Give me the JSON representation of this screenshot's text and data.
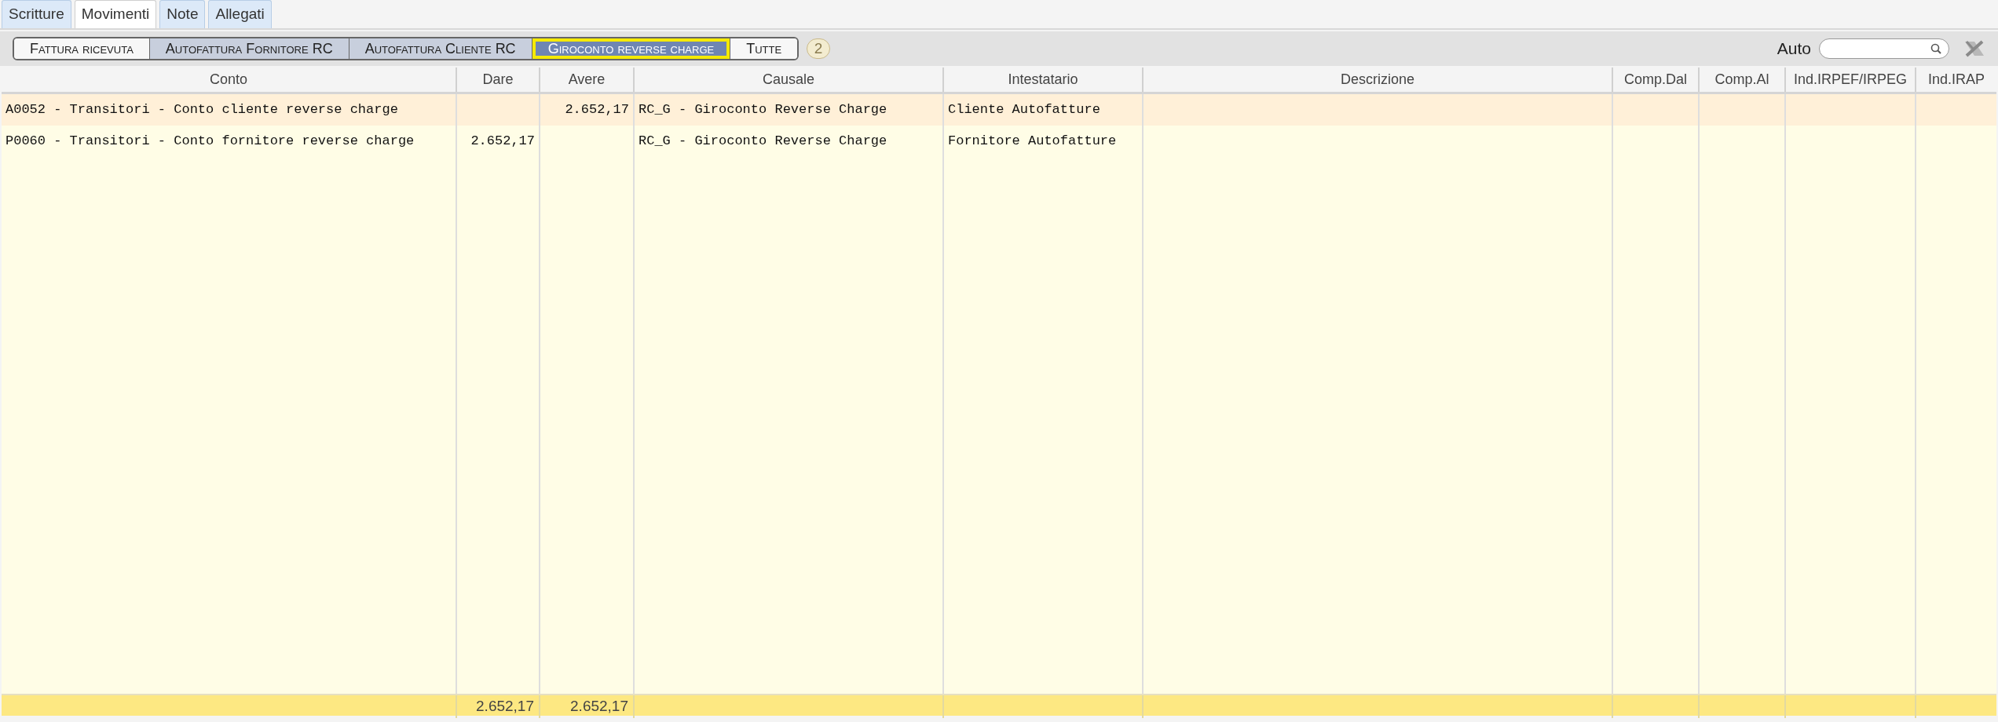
{
  "tabs": [
    {
      "label": "Scritture",
      "selected": false
    },
    {
      "label": "Movimenti",
      "selected": true
    },
    {
      "label": "Note",
      "selected": false
    },
    {
      "label": "Allegati",
      "selected": false
    }
  ],
  "filters": [
    {
      "label": "Fattura ricevuta",
      "selected": false,
      "shaded": false,
      "focused": false
    },
    {
      "label": "Autofattura Fornitore RC",
      "selected": false,
      "shaded": true,
      "focused": false
    },
    {
      "label": "Autofattura Cliente RC",
      "selected": false,
      "shaded": true,
      "focused": false
    },
    {
      "label": "Giroconto reverse charge",
      "selected": true,
      "focused": true
    },
    {
      "label": "Tutte",
      "selected": false,
      "shaded": false,
      "focused": false
    }
  ],
  "count_badge": "2",
  "search": {
    "label": "Auto"
  },
  "table": {
    "columns": [
      "Conto",
      "Dare",
      "Avere",
      "Causale",
      "Intestatario",
      "Descrizione",
      "Comp.Dal",
      "Comp.Al",
      "Ind.IRPEF/IRPEG",
      "Ind.IRAP"
    ],
    "rows": [
      {
        "selected": true,
        "cells": [
          "A0052 - Transitori - Conto cliente reverse charge",
          null,
          "2.652,17",
          "RC_G - Giroconto Reverse Charge",
          "Cliente Autofatture",
          null,
          null,
          null,
          null,
          null
        ]
      },
      {
        "selected": false,
        "cells": [
          "P0060 - Transitori - Conto fornitore reverse charge",
          "2.652,17",
          null,
          "RC_G - Giroconto Reverse Charge",
          "Fornitore Autofatture",
          null,
          null,
          null,
          null,
          null
        ]
      }
    ],
    "totals": {
      "dare": "2.652,17",
      "avere": "2.652,17"
    }
  }
}
